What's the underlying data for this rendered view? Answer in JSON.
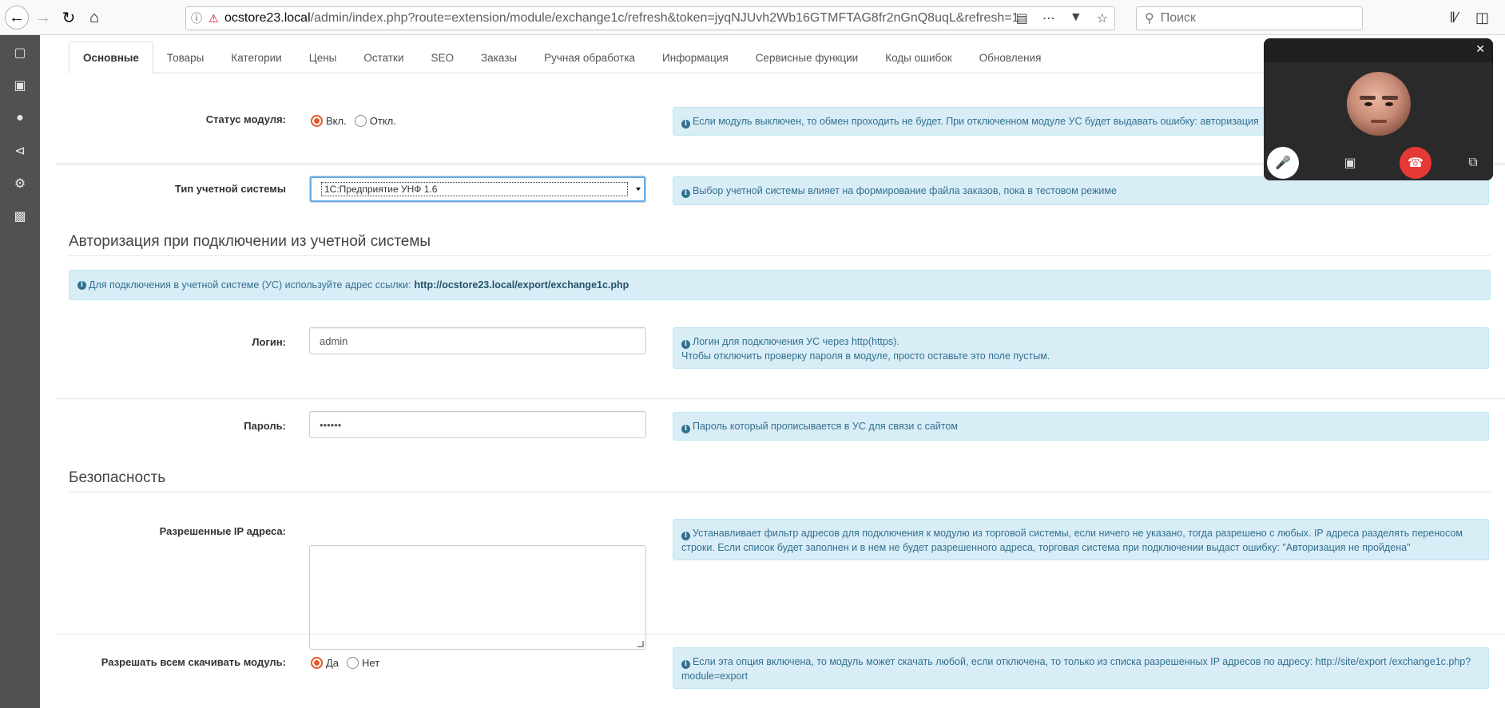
{
  "browser": {
    "url_host": "ocstore23.local",
    "url_path": "/admin/index.php?route=extension/module/exchange1c/refresh&token=jyqNJUvh2Wb16GTMFTAG8fr2nGnQ8uqL&refresh=1",
    "search_placeholder": "Поиск",
    "icons": [
      "back-icon",
      "forward-icon",
      "reload-icon",
      "home-icon",
      "info-icon",
      "insecure-lock-icon",
      "reader-icon",
      "more-icon",
      "pocket-icon",
      "bookmark-star-icon",
      "search-icon",
      "library-icon",
      "sidebar-icon"
    ]
  },
  "sidebar": {
    "icons": [
      "desktop-icon",
      "cart-icon",
      "user-icon",
      "share-icon",
      "gear-icon",
      "bar-chart-icon"
    ]
  },
  "tabs": [
    {
      "label": "Основные",
      "active": true
    },
    {
      "label": "Товары"
    },
    {
      "label": "Категории"
    },
    {
      "label": "Цены"
    },
    {
      "label": "Остатки"
    },
    {
      "label": "SEO"
    },
    {
      "label": "Заказы"
    },
    {
      "label": "Ручная обработка"
    },
    {
      "label": "Информация"
    },
    {
      "label": "Сервисные функции"
    },
    {
      "label": "Коды ошибок"
    },
    {
      "label": "Обновления"
    }
  ],
  "status": {
    "label": "Статус модуля:",
    "on_label": "Вкл.",
    "off_label": "Откл.",
    "selected": "on",
    "help": "Если модуль выключен, то обмен проходить не будет. При отключенном модуле УС будет выдавать ошибку: авторизация"
  },
  "system_type": {
    "label": "Тип учетной системы",
    "value": "1С:Предприятие УНФ 1.6",
    "help": "Выбор учетной системы влияет на формирование файла заказов, пока в тестовом режиме"
  },
  "auth_section": {
    "title": "Авторизация при подключении из учетной системы",
    "alert_text": "Для подключения в учетной системе (УС) используйте адрес ссылки:",
    "alert_link": "http://ocstore23.local/export/exchange1c.php"
  },
  "login": {
    "label": "Логин:",
    "value": "admin",
    "help_line1": "Логин для подключения УС через http(https).",
    "help_line2": "Чтобы отключить проверку пароля в модуле, просто оставьте это поле пустым."
  },
  "password": {
    "label": "Пароль:",
    "value": "••••••",
    "help": "Пароль который прописывается в УС для связи с сайтом"
  },
  "security_section": {
    "title": "Безопасность"
  },
  "allowed_ip": {
    "label": "Разрешенные IP адреса:",
    "value": "",
    "help": "Устанавливает фильтр адресов для подключения к модулю из торговой системы, если ничего не указано, тогда разрешено с любых. IP адреса разделять переносом строки. Если список будет заполнен и в нем не будет разрешенного адреса, торговая система при подключении выдаст ошибку: \"Авторизация не пройдена\""
  },
  "allow_download": {
    "label": "Разрешать всем скачивать модуль:",
    "yes_label": "Да",
    "no_label": "Нет",
    "selected": "yes",
    "help": "Если эта опция включена, то модуль может скачать любой, если отключена, то только из списка разрешенных IP адресов по адресу: http://site/export /exchange1c.php?module=export"
  },
  "video_call": {
    "icons": [
      "close-icon",
      "microphone-icon",
      "camera-off-icon",
      "hang-up-icon",
      "swap-window-icon"
    ],
    "end_color": "#e53935"
  }
}
